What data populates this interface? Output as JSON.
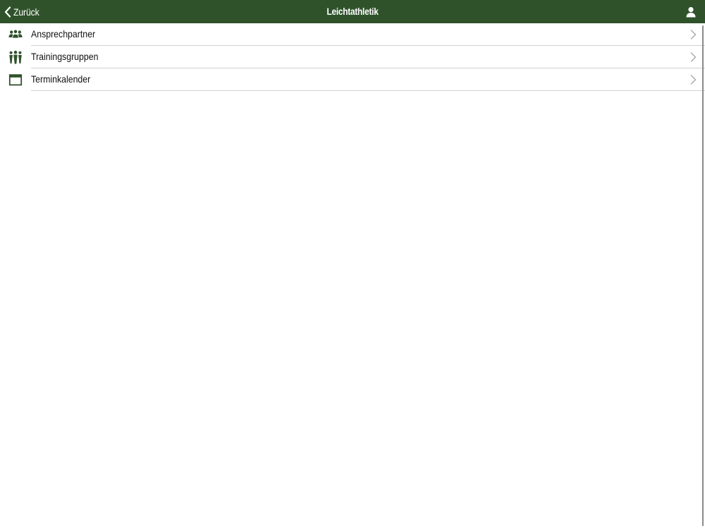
{
  "navbar": {
    "back_label": "Zurück",
    "title": "Leichtathletik",
    "background": "#2f522b"
  },
  "list": {
    "items": [
      {
        "label": "Ansprechpartner",
        "icon": "contacts-icon"
      },
      {
        "label": "Trainingsgruppen",
        "icon": "group-icon"
      },
      {
        "label": "Terminkalender",
        "icon": "calendar-icon"
      }
    ]
  },
  "colors": {
    "accent": "#2f522b",
    "separator": "#cfcfcf",
    "chevron": "#a8a8a8",
    "text": "#111111"
  }
}
